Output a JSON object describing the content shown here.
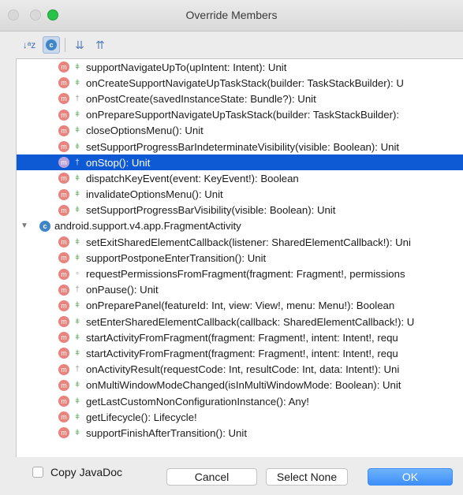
{
  "window": {
    "title": "Override Members"
  },
  "toolbar": {
    "sort_glyph": "↓ᵃz",
    "class_glyph": "c",
    "expand_glyph": "⇊",
    "collapse_glyph": "⇈"
  },
  "tree": {
    "group_before": [
      {
        "vis": "pub",
        "sig": "supportNavigateUpTo(upIntent: Intent): Unit"
      },
      {
        "vis": "pub",
        "sig": "onCreateSupportNavigateUpTaskStack(builder: TaskStackBuilder): U"
      },
      {
        "vis": "prot",
        "sig": "onPostCreate(savedInstanceState: Bundle?): Unit"
      },
      {
        "vis": "pub",
        "sig": "onPrepareSupportNavigateUpTaskStack(builder: TaskStackBuilder):"
      },
      {
        "vis": "pub",
        "sig": "closeOptionsMenu(): Unit"
      },
      {
        "vis": "pub",
        "sig": "setSupportProgressBarIndeterminateVisibility(visible: Boolean): Unit"
      },
      {
        "vis": "prot",
        "sig": "onStop(): Unit",
        "selected": true
      },
      {
        "vis": "pub",
        "sig": "dispatchKeyEvent(event: KeyEvent!): Boolean"
      },
      {
        "vis": "pub",
        "sig": "invalidateOptionsMenu(): Unit"
      },
      {
        "vis": "pub",
        "sig": "setSupportProgressBarVisibility(visible: Boolean): Unit"
      }
    ],
    "group_name": "android.support.v4.app.FragmentActivity",
    "group_after": [
      {
        "vis": "pub",
        "sig": "setExitSharedElementCallback(listener: SharedElementCallback!): Uni"
      },
      {
        "vis": "pub",
        "sig": "supportPostponeEnterTransition(): Unit"
      },
      {
        "vis": "pkg",
        "sig": "requestPermissionsFromFragment(fragment: Fragment!, permissions"
      },
      {
        "vis": "prot",
        "sig": "onPause(): Unit"
      },
      {
        "vis": "pub",
        "sig": "onPreparePanel(featureId: Int, view: View!, menu: Menu!): Boolean"
      },
      {
        "vis": "pub",
        "sig": "setEnterSharedElementCallback(callback: SharedElementCallback!): U"
      },
      {
        "vis": "pub",
        "sig": "startActivityFromFragment(fragment: Fragment!, intent: Intent!, requ"
      },
      {
        "vis": "pub",
        "sig": "startActivityFromFragment(fragment: Fragment!, intent: Intent!, requ"
      },
      {
        "vis": "prot",
        "sig": "onActivityResult(requestCode: Int, resultCode: Int, data: Intent!): Uni"
      },
      {
        "vis": "pub",
        "sig": "onMultiWindowModeChanged(isInMultiWindowMode: Boolean): Unit"
      },
      {
        "vis": "pub",
        "sig": "getLastCustomNonConfigurationInstance(): Any!"
      },
      {
        "vis": "pub",
        "sig": "getLifecycle(): Lifecycle!"
      },
      {
        "vis": "pub",
        "sig": "supportFinishAfterTransition(): Unit"
      }
    ],
    "method_badge": "m",
    "class_badge": "c",
    "expander": "▼"
  },
  "footer": {
    "copy_javadoc_label": "Copy JavaDoc",
    "cancel_label": "Cancel",
    "select_none_label": "Select None",
    "ok_label": "OK"
  },
  "colors": {
    "selection": "#0e5ad5",
    "method_icon": "#e8837e",
    "class_icon": "#3e86c6",
    "ok_button": "#3c8ff8"
  }
}
